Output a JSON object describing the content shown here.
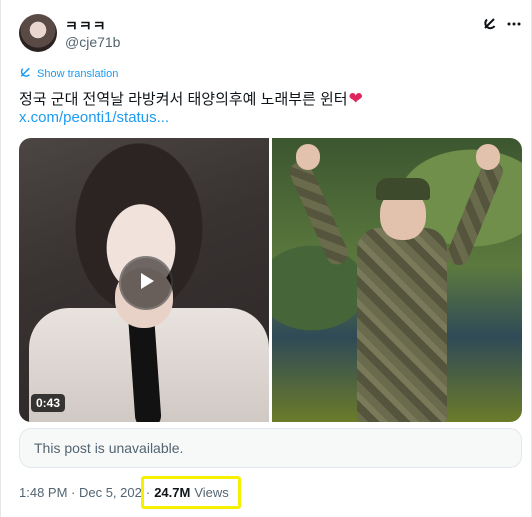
{
  "author": {
    "display_name": "ㅋㅋㅋ",
    "handle": "@cje71b"
  },
  "translate": {
    "label": "Show translation",
    "icon": "translate-icon"
  },
  "post": {
    "text": "정국 군대 전역날 라방켜서 태양의후예 노래부른 윈터",
    "emoji": "❤",
    "link": "x.com/peonti1/status..."
  },
  "media": {
    "video_duration": "0:43",
    "play_icon": "play-icon"
  },
  "quoted": {
    "unavailable_text": "This post is unavailable."
  },
  "meta": {
    "timestamp": "1:48 PM · Dec 5, 202",
    "separator": "·",
    "views_count": "24.7M",
    "views_label": "Views"
  },
  "colors": {
    "link": "#1d9bf0",
    "highlight": "#f5ef00",
    "heart": "#e0245e"
  }
}
